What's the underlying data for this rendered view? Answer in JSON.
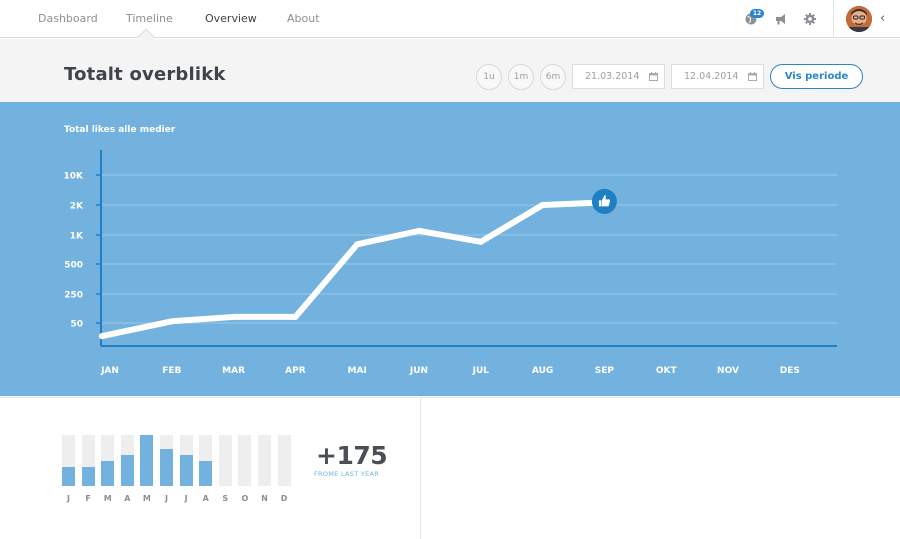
{
  "nav": {
    "tabs": [
      {
        "label": "Dashboard",
        "active": false
      },
      {
        "label": "Timeline",
        "active": false
      },
      {
        "label": "Overview",
        "active": true
      },
      {
        "label": "About",
        "active": false
      }
    ],
    "notification_count": "12",
    "icons": [
      "globe-icon",
      "megaphone-icon",
      "gear-icon",
      "chevron-left-icon"
    ]
  },
  "header": {
    "title": "Totalt overblikk",
    "ranges": [
      "1u",
      "1m",
      "6m"
    ],
    "date_from": "21.03.2014",
    "date_to": "12.04.2014",
    "submit_label": "Vis periode"
  },
  "colors": {
    "accent": "#2a86c7",
    "chart_bg": "#73b2df",
    "header_bg": "#f4f4f4"
  },
  "chart_data": {
    "type": "line",
    "title": "Total likes alle medier",
    "categories": [
      "JAN",
      "FEB",
      "MAR",
      "APR",
      "MAI",
      "JUN",
      "JUL",
      "AUG",
      "SEP",
      "OKT",
      "NOV",
      "DES"
    ],
    "y_ticks": [
      "10K",
      "2K",
      "1K",
      "500",
      "250",
      "50"
    ],
    "y_scale": "ordinal-log",
    "series": [
      {
        "values": [
          20,
          55,
          70,
          70,
          800,
          1100,
          850,
          2000,
          2300
        ]
      }
    ],
    "end_marker": "thumbs-up-icon",
    "grid": true
  },
  "monthly_summary": {
    "months": [
      "J",
      "F",
      "M",
      "A",
      "M",
      "J",
      "J",
      "A",
      "S",
      "O",
      "N",
      "D"
    ],
    "levels": [
      0.37,
      0.37,
      0.49,
      0.61,
      1.0,
      0.73,
      0.61,
      0.49,
      0,
      0,
      0,
      0
    ],
    "value": "+175",
    "caption": "FROME LAST YEAR"
  }
}
